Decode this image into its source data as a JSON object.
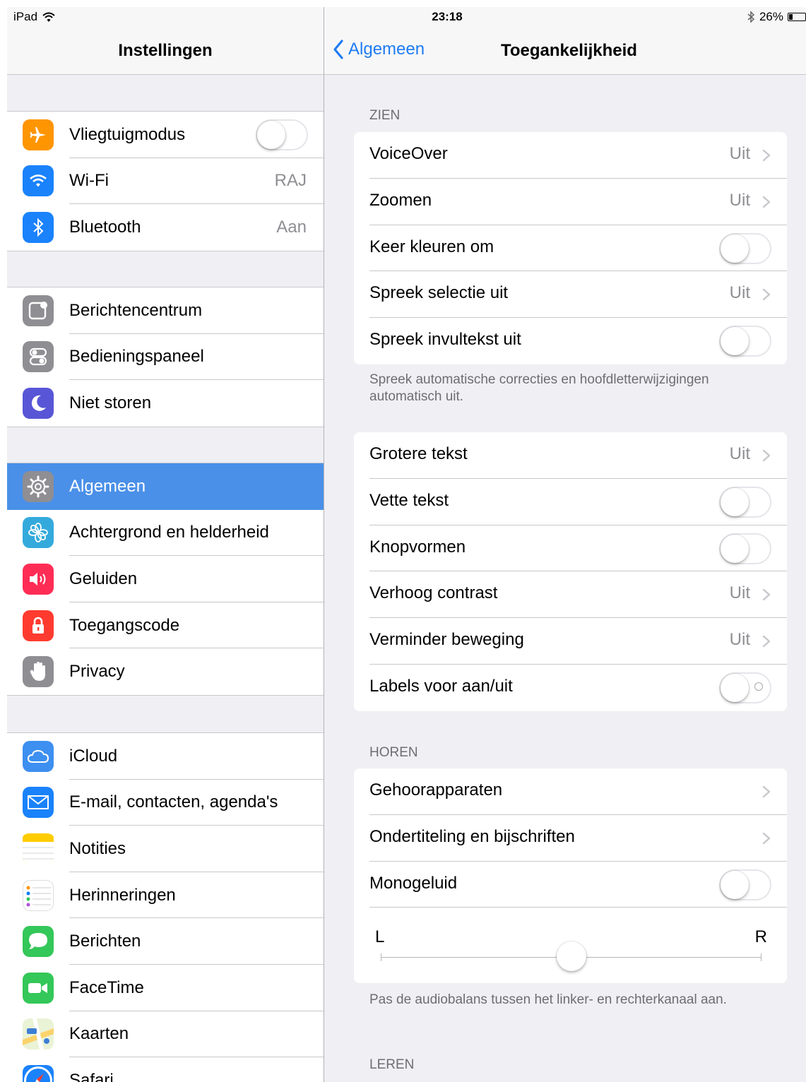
{
  "status": {
    "device": "iPad",
    "time": "23:18",
    "battery": "26%",
    "battery_level": 0.26
  },
  "master": {
    "title": "Instellingen",
    "groups": [
      {
        "items": [
          {
            "label": "Vliegtuigmodus",
            "icon": "airplane-icon",
            "color": "#ff9500",
            "toggle": false
          },
          {
            "label": "Wi-Fi",
            "value": "RAJ",
            "icon": "wifi-icon",
            "color": "#1a82fb"
          },
          {
            "label": "Bluetooth",
            "value": "Aan",
            "icon": "bluetooth-icon",
            "color": "#1a82fb"
          }
        ]
      },
      {
        "items": [
          {
            "label": "Berichtencentrum",
            "icon": "notification-center-icon",
            "color": "#8e8e93"
          },
          {
            "label": "Bedieningspaneel",
            "icon": "control-center-icon",
            "color": "#8e8e93"
          },
          {
            "label": "Niet storen",
            "icon": "moon-icon",
            "color": "#5856d6"
          }
        ]
      },
      {
        "items": [
          {
            "label": "Algemeen",
            "icon": "gear-icon",
            "color": "#8e8e93",
            "selected": true
          },
          {
            "label": "Achtergrond en helderheid",
            "icon": "flower-icon",
            "color": "#34aadc"
          },
          {
            "label": "Geluiden",
            "icon": "speaker-icon",
            "color": "#ff2d55"
          },
          {
            "label": "Toegangscode",
            "icon": "lock-icon",
            "color": "#ff3b30"
          },
          {
            "label": "Privacy",
            "icon": "hand-icon",
            "color": "#8e8e93"
          }
        ]
      },
      {
        "items": [
          {
            "label": "iCloud",
            "icon": "cloud-icon",
            "color": "#3d8ff0"
          },
          {
            "label": "E-mail, contacten, agenda's",
            "icon": "mail-icon",
            "color": "#1a82fb"
          },
          {
            "label": "Notities",
            "icon": "notes-icon",
            "color": "#ffcc00"
          },
          {
            "label": "Herinneringen",
            "icon": "reminders-icon",
            "color": "#ffffff"
          },
          {
            "label": "Berichten",
            "icon": "messages-icon",
            "color": "#34c759"
          },
          {
            "label": "FaceTime",
            "icon": "facetime-icon",
            "color": "#34c759"
          },
          {
            "label": "Kaarten",
            "icon": "maps-icon",
            "color": "#f2f2f2"
          },
          {
            "label": "Safari",
            "icon": "compass-icon",
            "color": "#1a82fb"
          }
        ]
      }
    ]
  },
  "detail": {
    "back_label": "Algemeen",
    "title": "Toegankelijkheid",
    "sections": [
      {
        "header": "ZIEN",
        "rows": [
          {
            "label": "VoiceOver",
            "value": "Uit",
            "type": "disclosure"
          },
          {
            "label": "Zoomen",
            "value": "Uit",
            "type": "disclosure"
          },
          {
            "label": "Keer kleuren om",
            "type": "toggle",
            "on": false
          },
          {
            "label": "Spreek selectie uit",
            "value": "Uit",
            "type": "disclosure"
          },
          {
            "label": "Spreek invultekst uit",
            "type": "toggle",
            "on": false
          }
        ],
        "footer": "Spreek automatische correcties en hoofdletterwijzigingen automatisch uit."
      },
      {
        "header": "",
        "rows": [
          {
            "label": "Grotere tekst",
            "value": "Uit",
            "type": "disclosure"
          },
          {
            "label": "Vette tekst",
            "type": "toggle",
            "on": false
          },
          {
            "label": "Knopvormen",
            "type": "toggle",
            "on": false
          },
          {
            "label": "Verhoog contrast",
            "value": "Uit",
            "type": "disclosure"
          },
          {
            "label": "Verminder beweging",
            "value": "Uit",
            "type": "disclosure"
          },
          {
            "label": "Labels voor aan/uit",
            "type": "toggle",
            "on": false,
            "labels": true
          }
        ]
      },
      {
        "header": "HOREN",
        "rows": [
          {
            "label": "Gehoorapparaten",
            "type": "disclosure"
          },
          {
            "label": "Ondertiteling en bijschriften",
            "type": "disclosure"
          },
          {
            "label": "Monogeluid",
            "type": "toggle",
            "on": false
          }
        ],
        "balance": {
          "left_label": "L",
          "right_label": "R",
          "value": 0.5
        },
        "footer": "Pas de audiobalans tussen het linker- en rechterkanaal aan."
      },
      {
        "header": "LEREN",
        "rows": []
      }
    ]
  }
}
